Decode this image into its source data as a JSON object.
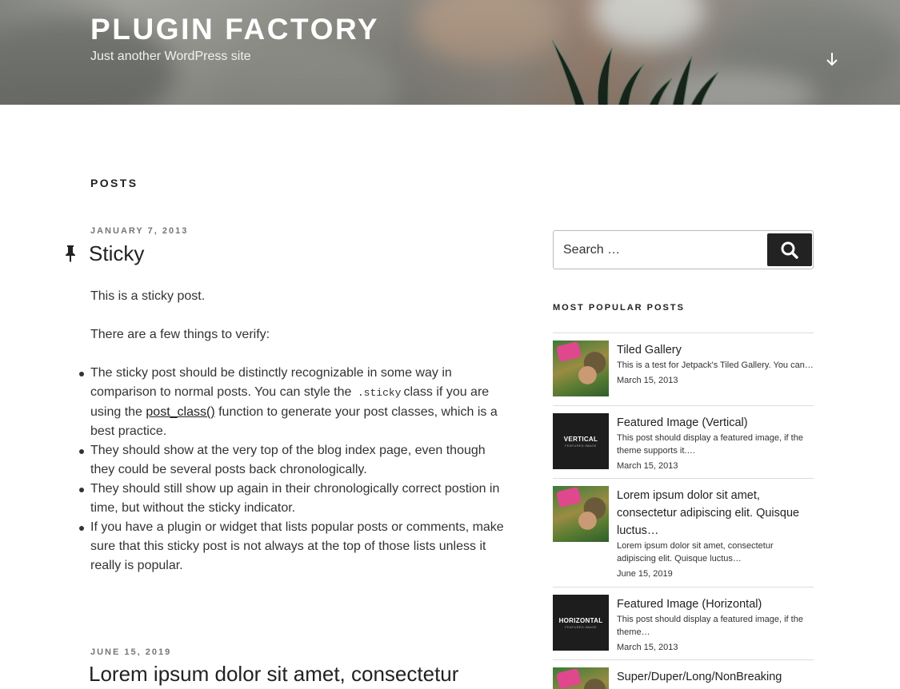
{
  "header": {
    "site_title": "PLUGIN FACTORY",
    "tagline": "Just another WordPress site",
    "scroll_icon": "arrow-down-icon"
  },
  "main": {
    "page_title": "POSTS",
    "posts": [
      {
        "date": "JANUARY 7, 2013",
        "title": "Sticky",
        "sticky": true,
        "paragraphs": [
          "This is a sticky post.",
          "There are a few things to verify:"
        ],
        "bullets": {
          "b1_a": "The sticky post should be distinctly recognizable in some way in comparison to normal posts. You can style the",
          "b1_code": ".sticky",
          "b1_b": "class if you are using the",
          "b1_link": "post_class()",
          "b1_c": "function to generate your post classes, which is a best practice.",
          "b2": "They should show at the very top of the blog index page, even though they could be several posts back chronologically.",
          "b3": "They should still show up again in their chronologically correct postion in time, but without the sticky indicator.",
          "b4": "If you have a plugin or widget that lists popular posts or comments, make sure that this sticky post is not always at the top of those lists unless it really is popular."
        }
      },
      {
        "date": "JUNE 15, 2019",
        "title": "Lorem ipsum dolor sit amet, consectetur"
      }
    ]
  },
  "sidebar": {
    "search": {
      "placeholder": "Search …",
      "button_icon": "search-icon"
    },
    "popular": {
      "title": "MOST POPULAR POSTS",
      "items": [
        {
          "title": "Tiled Gallery",
          "excerpt": "This is a test for Jetpack's Tiled Gallery. You can…",
          "date": "March 15, 2013",
          "thumb": "photo"
        },
        {
          "title": "Featured Image (Vertical)",
          "excerpt": "This post should display a featured image, if the theme supports it.…",
          "date": "March 15, 2013",
          "thumb": "dark",
          "thumb_word": "VERTICAL",
          "thumb_sub": "FEATURED IMAGE"
        },
        {
          "title": "Lorem ipsum dolor sit amet, consectetur adipiscing elit. Quisque luctus…",
          "excerpt": "Lorem ipsum dolor sit amet, consectetur adipiscing elit. Quisque luctus…",
          "date": "June 15, 2019",
          "thumb": "photo"
        },
        {
          "title": "Featured Image (Horizontal)",
          "excerpt": "This post should display a featured image, if the theme…",
          "date": "March 15, 2013",
          "thumb": "dark",
          "thumb_word": "HORIZONTAL",
          "thumb_sub": "FEATURED IMAGE"
        },
        {
          "title": "Super/Duper/Long/NonBreaking",
          "thumb": "photo"
        }
      ]
    }
  }
}
